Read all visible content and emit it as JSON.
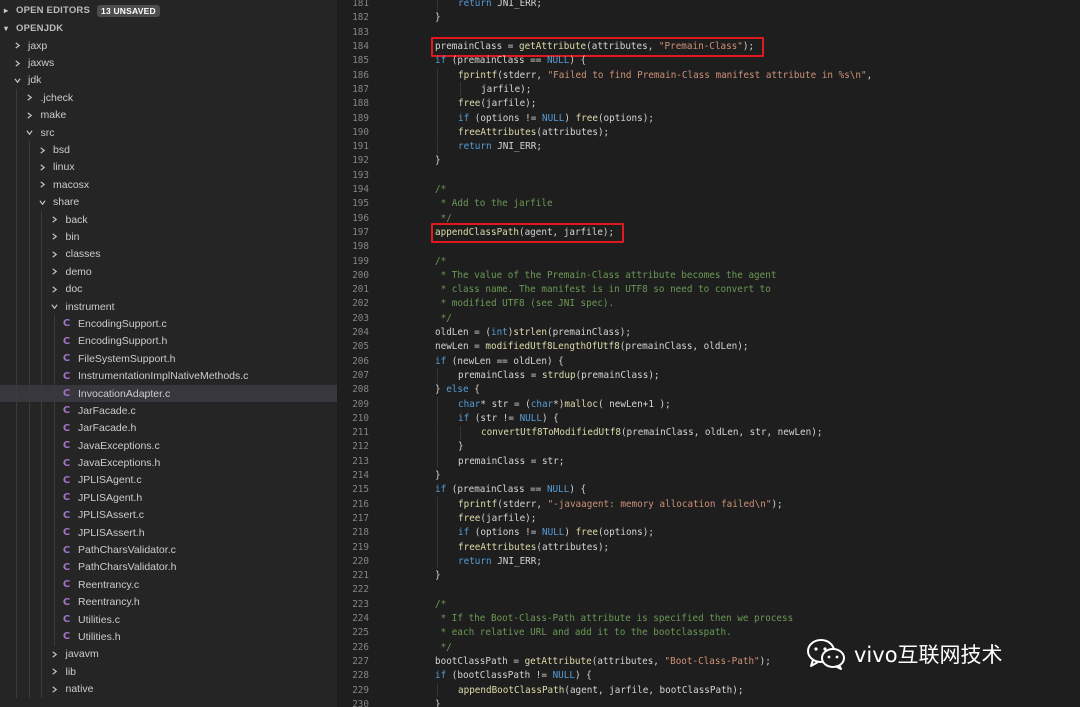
{
  "explorer": {
    "open_editors_label": "OPEN EDITORS",
    "unsaved_badge": "13 UNSAVED",
    "project_label": "OPENJDK",
    "tree": [
      {
        "label": "jaxp",
        "depth": 0,
        "type": "folder",
        "expanded": false
      },
      {
        "label": "jaxws",
        "depth": 0,
        "type": "folder",
        "expanded": false
      },
      {
        "label": "jdk",
        "depth": 0,
        "type": "folder",
        "expanded": true
      },
      {
        "label": ".jcheck",
        "depth": 1,
        "type": "folder",
        "expanded": false
      },
      {
        "label": "make",
        "depth": 1,
        "type": "folder",
        "expanded": false
      },
      {
        "label": "src",
        "depth": 1,
        "type": "folder",
        "expanded": true
      },
      {
        "label": "bsd",
        "depth": 2,
        "type": "folder",
        "expanded": false
      },
      {
        "label": "linux",
        "depth": 2,
        "type": "folder",
        "expanded": false
      },
      {
        "label": "macosx",
        "depth": 2,
        "type": "folder",
        "expanded": false
      },
      {
        "label": "share",
        "depth": 2,
        "type": "folder",
        "expanded": true
      },
      {
        "label": "back",
        "depth": 3,
        "type": "folder",
        "expanded": false
      },
      {
        "label": "bin",
        "depth": 3,
        "type": "folder",
        "expanded": false
      },
      {
        "label": "classes",
        "depth": 3,
        "type": "folder",
        "expanded": false
      },
      {
        "label": "demo",
        "depth": 3,
        "type": "folder",
        "expanded": false
      },
      {
        "label": "doc",
        "depth": 3,
        "type": "folder",
        "expanded": false
      },
      {
        "label": "instrument",
        "depth": 3,
        "type": "folder",
        "expanded": true
      },
      {
        "label": "EncodingSupport.c",
        "depth": 4,
        "type": "file"
      },
      {
        "label": "EncodingSupport.h",
        "depth": 4,
        "type": "file"
      },
      {
        "label": "FileSystemSupport.h",
        "depth": 4,
        "type": "file"
      },
      {
        "label": "InstrumentationImplNativeMethods.c",
        "depth": 4,
        "type": "file"
      },
      {
        "label": "InvocationAdapter.c",
        "depth": 4,
        "type": "file",
        "selected": true
      },
      {
        "label": "JarFacade.c",
        "depth": 4,
        "type": "file"
      },
      {
        "label": "JarFacade.h",
        "depth": 4,
        "type": "file"
      },
      {
        "label": "JavaExceptions.c",
        "depth": 4,
        "type": "file"
      },
      {
        "label": "JavaExceptions.h",
        "depth": 4,
        "type": "file"
      },
      {
        "label": "JPLISAgent.c",
        "depth": 4,
        "type": "file"
      },
      {
        "label": "JPLISAgent.h",
        "depth": 4,
        "type": "file"
      },
      {
        "label": "JPLISAssert.c",
        "depth": 4,
        "type": "file"
      },
      {
        "label": "JPLISAssert.h",
        "depth": 4,
        "type": "file"
      },
      {
        "label": "PathCharsValidator.c",
        "depth": 4,
        "type": "file"
      },
      {
        "label": "PathCharsValidator.h",
        "depth": 4,
        "type": "file"
      },
      {
        "label": "Reentrancy.c",
        "depth": 4,
        "type": "file"
      },
      {
        "label": "Reentrancy.h",
        "depth": 4,
        "type": "file"
      },
      {
        "label": "Utilities.c",
        "depth": 4,
        "type": "file"
      },
      {
        "label": "Utilities.h",
        "depth": 4,
        "type": "file"
      },
      {
        "label": "javavm",
        "depth": 3,
        "type": "folder",
        "expanded": false
      },
      {
        "label": "lib",
        "depth": 3,
        "type": "folder",
        "expanded": false
      },
      {
        "label": "native",
        "depth": 3,
        "type": "folder",
        "expanded": false
      }
    ],
    "file_icon_letter": "C"
  },
  "editor": {
    "lines": [
      {
        "n": "181",
        "i": 2,
        "t": [
          [
            "kw",
            "return"
          ],
          [
            "v",
            " JNI_ERR;"
          ]
        ]
      },
      {
        "n": "182",
        "i": 1,
        "t": [
          [
            "v",
            "}"
          ]
        ]
      },
      {
        "n": "183",
        "i": 0,
        "t": []
      },
      {
        "n": "184",
        "i": 1,
        "t": [
          [
            "v",
            "premainClass = "
          ],
          [
            "fn",
            "getAttribute"
          ],
          [
            "v",
            "(attributes, "
          ],
          [
            "str",
            "\"Premain-Class\""
          ],
          [
            "v",
            ");"
          ]
        ],
        "hl": true
      },
      {
        "n": "185",
        "i": 1,
        "t": [
          [
            "kw",
            "if"
          ],
          [
            "v",
            " (premainClass == "
          ],
          [
            "kw",
            "NULL"
          ],
          [
            "v",
            ") {"
          ]
        ]
      },
      {
        "n": "186",
        "i": 2,
        "t": [
          [
            "fn",
            "fprintf"
          ],
          [
            "v",
            "(stderr, "
          ],
          [
            "str",
            "\"Failed to find Premain-Class manifest attribute in %s\\n\""
          ],
          [
            "v",
            ","
          ]
        ]
      },
      {
        "n": "187",
        "i": 3,
        "t": [
          [
            "v",
            "jarfile);"
          ]
        ]
      },
      {
        "n": "188",
        "i": 2,
        "t": [
          [
            "fn",
            "free"
          ],
          [
            "v",
            "(jarfile);"
          ]
        ]
      },
      {
        "n": "189",
        "i": 2,
        "t": [
          [
            "kw",
            "if"
          ],
          [
            "v",
            " (options != "
          ],
          [
            "kw",
            "NULL"
          ],
          [
            "v",
            ") "
          ],
          [
            "fn",
            "free"
          ],
          [
            "v",
            "(options);"
          ]
        ]
      },
      {
        "n": "190",
        "i": 2,
        "t": [
          [
            "fn",
            "freeAttributes"
          ],
          [
            "v",
            "(attributes);"
          ]
        ]
      },
      {
        "n": "191",
        "i": 2,
        "t": [
          [
            "kw",
            "return"
          ],
          [
            "v",
            " JNI_ERR;"
          ]
        ]
      },
      {
        "n": "192",
        "i": 1,
        "t": [
          [
            "v",
            "}"
          ]
        ]
      },
      {
        "n": "193",
        "i": 0,
        "t": []
      },
      {
        "n": "194",
        "i": 1,
        "t": [
          [
            "cm",
            "/*"
          ]
        ]
      },
      {
        "n": "195",
        "i": 1,
        "t": [
          [
            "cm",
            " * Add to the jarfile"
          ]
        ]
      },
      {
        "n": "196",
        "i": 1,
        "t": [
          [
            "cm",
            " */"
          ]
        ]
      },
      {
        "n": "197",
        "i": 1,
        "t": [
          [
            "fn",
            "appendClassPath"
          ],
          [
            "v",
            "(agent, jarfile);"
          ]
        ],
        "hl": true
      },
      {
        "n": "198",
        "i": 0,
        "t": []
      },
      {
        "n": "199",
        "i": 1,
        "t": [
          [
            "cm",
            "/*"
          ]
        ]
      },
      {
        "n": "200",
        "i": 1,
        "t": [
          [
            "cm",
            " * The value of the Premain-Class attribute becomes the agent"
          ]
        ]
      },
      {
        "n": "201",
        "i": 1,
        "t": [
          [
            "cm",
            " * class name. The manifest is in UTF8 so need to convert to"
          ]
        ]
      },
      {
        "n": "202",
        "i": 1,
        "t": [
          [
            "cm",
            " * modified UTF8 (see JNI spec)."
          ]
        ]
      },
      {
        "n": "203",
        "i": 1,
        "t": [
          [
            "cm",
            " */"
          ]
        ]
      },
      {
        "n": "204",
        "i": 1,
        "t": [
          [
            "v",
            "oldLen = ("
          ],
          [
            "kw",
            "int"
          ],
          [
            "v",
            ")"
          ],
          [
            "fn",
            "strlen"
          ],
          [
            "v",
            "(premainClass);"
          ]
        ]
      },
      {
        "n": "205",
        "i": 1,
        "t": [
          [
            "v",
            "newLen = "
          ],
          [
            "fn",
            "modifiedUtf8LengthOfUtf8"
          ],
          [
            "v",
            "(premainClass, oldLen);"
          ]
        ]
      },
      {
        "n": "206",
        "i": 1,
        "t": [
          [
            "kw",
            "if"
          ],
          [
            "v",
            " (newLen == oldLen) {"
          ]
        ]
      },
      {
        "n": "207",
        "i": 2,
        "t": [
          [
            "v",
            "premainClass = "
          ],
          [
            "fn",
            "strdup"
          ],
          [
            "v",
            "(premainClass);"
          ]
        ]
      },
      {
        "n": "208",
        "i": 1,
        "t": [
          [
            "v",
            "} "
          ],
          [
            "kw",
            "else"
          ],
          [
            "v",
            " {"
          ]
        ]
      },
      {
        "n": "209",
        "i": 2,
        "t": [
          [
            "kw",
            "char"
          ],
          [
            "v",
            "* str = ("
          ],
          [
            "kw",
            "char"
          ],
          [
            "v",
            "*)"
          ],
          [
            "fn",
            "malloc"
          ],
          [
            "v",
            "( newLen+1 );"
          ]
        ]
      },
      {
        "n": "210",
        "i": 2,
        "t": [
          [
            "kw",
            "if"
          ],
          [
            "v",
            " (str != "
          ],
          [
            "kw",
            "NULL"
          ],
          [
            "v",
            ") {"
          ]
        ]
      },
      {
        "n": "211",
        "i": 3,
        "t": [
          [
            "fn",
            "convertUtf8ToModifiedUtf8"
          ],
          [
            "v",
            "(premainClass, oldLen, str, newLen);"
          ]
        ]
      },
      {
        "n": "212",
        "i": 2,
        "t": [
          [
            "v",
            "}"
          ]
        ]
      },
      {
        "n": "213",
        "i": 2,
        "t": [
          [
            "v",
            "premainClass = str;"
          ]
        ]
      },
      {
        "n": "214",
        "i": 1,
        "t": [
          [
            "v",
            "}"
          ]
        ]
      },
      {
        "n": "215",
        "i": 1,
        "t": [
          [
            "kw",
            "if"
          ],
          [
            "v",
            " (premainClass == "
          ],
          [
            "kw",
            "NULL"
          ],
          [
            "v",
            ") {"
          ]
        ]
      },
      {
        "n": "216",
        "i": 2,
        "t": [
          [
            "fn",
            "fprintf"
          ],
          [
            "v",
            "(stderr, "
          ],
          [
            "str",
            "\"-javaagent: memory allocation failed\\n\""
          ],
          [
            "v",
            ");"
          ]
        ]
      },
      {
        "n": "217",
        "i": 2,
        "t": [
          [
            "fn",
            "free"
          ],
          [
            "v",
            "(jarfile);"
          ]
        ]
      },
      {
        "n": "218",
        "i": 2,
        "t": [
          [
            "kw",
            "if"
          ],
          [
            "v",
            " (options != "
          ],
          [
            "kw",
            "NULL"
          ],
          [
            "v",
            ") "
          ],
          [
            "fn",
            "free"
          ],
          [
            "v",
            "(options);"
          ]
        ]
      },
      {
        "n": "219",
        "i": 2,
        "t": [
          [
            "fn",
            "freeAttributes"
          ],
          [
            "v",
            "(attributes);"
          ]
        ]
      },
      {
        "n": "220",
        "i": 2,
        "t": [
          [
            "kw",
            "return"
          ],
          [
            "v",
            " JNI_ERR;"
          ]
        ]
      },
      {
        "n": "221",
        "i": 1,
        "t": [
          [
            "v",
            "}"
          ]
        ]
      },
      {
        "n": "222",
        "i": 0,
        "t": []
      },
      {
        "n": "223",
        "i": 1,
        "t": [
          [
            "cm",
            "/*"
          ]
        ]
      },
      {
        "n": "224",
        "i": 1,
        "t": [
          [
            "cm",
            " * If the Boot-Class-Path attribute is specified then we process"
          ]
        ]
      },
      {
        "n": "225",
        "i": 1,
        "t": [
          [
            "cm",
            " * each relative URL and add it to the bootclasspath."
          ]
        ]
      },
      {
        "n": "226",
        "i": 1,
        "t": [
          [
            "cm",
            " */"
          ]
        ]
      },
      {
        "n": "227",
        "i": 1,
        "t": [
          [
            "v",
            "bootClassPath = "
          ],
          [
            "fn",
            "getAttribute"
          ],
          [
            "v",
            "(attributes, "
          ],
          [
            "str",
            "\"Boot-Class-Path\""
          ],
          [
            "v",
            ");"
          ]
        ]
      },
      {
        "n": "228",
        "i": 1,
        "t": [
          [
            "kw",
            "if"
          ],
          [
            "v",
            " (bootClassPath != "
          ],
          [
            "kw",
            "NULL"
          ],
          [
            "v",
            ") {"
          ]
        ]
      },
      {
        "n": "229",
        "i": 2,
        "t": [
          [
            "fn",
            "appendBootClassPath"
          ],
          [
            "v",
            "(agent, jarfile, bootClassPath);"
          ]
        ]
      },
      {
        "n": "230",
        "i": 1,
        "t": [
          [
            "v",
            "}"
          ]
        ]
      }
    ]
  },
  "watermark": {
    "text": "vivo互联网技术",
    "icon": "wechat-icon"
  },
  "colors": {
    "highlight_box": "#e0191f",
    "c_file_icon": "#a074c4",
    "keyword": "#569cd6",
    "function": "#dcdcaa",
    "string": "#ce9178",
    "comment": "#6a9955"
  }
}
